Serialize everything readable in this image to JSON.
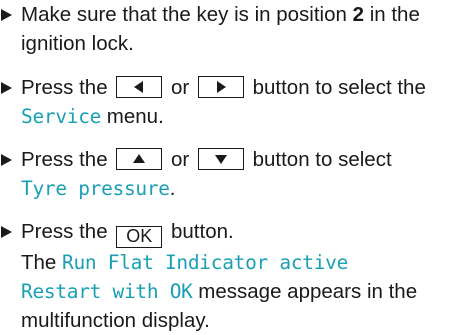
{
  "steps": [
    {
      "pre": "Make sure that the key is in position ",
      "bold": "2",
      "post": " in the ignition lock."
    },
    {
      "pre": "Press the ",
      "key1": "left-arrow",
      "mid": " or ",
      "key2": "right-arrow",
      "post": " button to select the",
      "display": "Service",
      "tail": " menu."
    },
    {
      "pre": "Press the ",
      "key1": "up-arrow",
      "mid": " or ",
      "key2": "down-arrow",
      "post": " button to select",
      "display": "Tyre pressure",
      "tail": "."
    },
    {
      "pre": "Press the ",
      "key": "OK",
      "post": " button.",
      "line2": "The ",
      "display1": "Run Flat Indicator active",
      "display2": "Restart with OK",
      "tail": " message appears in the multifunction display."
    }
  ],
  "colors": {
    "display_text": "#1aa0b4",
    "text": "#1a1a1a"
  }
}
